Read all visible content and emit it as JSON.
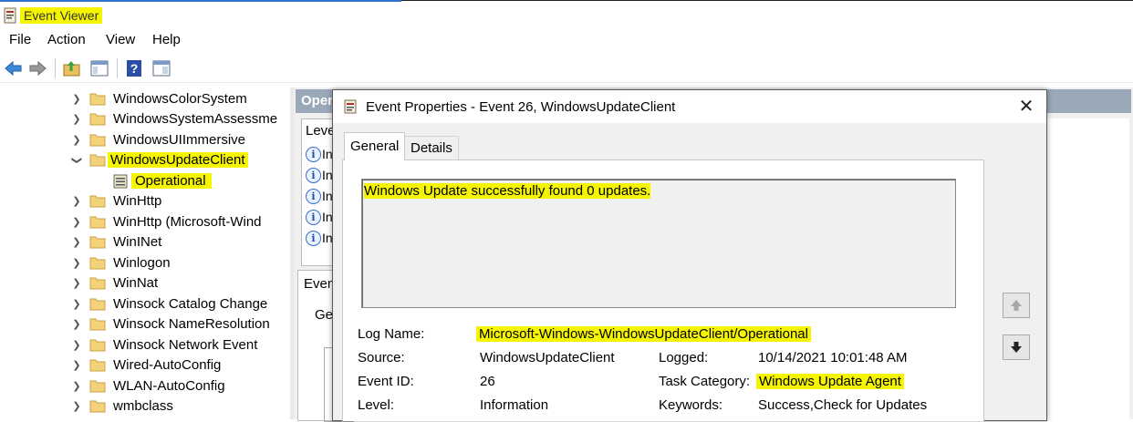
{
  "window": {
    "title": "Event Viewer"
  },
  "menu": [
    "File",
    "Action",
    "View",
    "Help"
  ],
  "toolbar": {
    "icons": [
      "back-arrow-icon",
      "forward-arrow-icon",
      "up-folder-icon",
      "show-hide-tree-icon",
      "help-icon",
      "properties-icon"
    ]
  },
  "tree": {
    "items": [
      {
        "label": "WindowsColorSystem",
        "expanded": false,
        "type": "folder"
      },
      {
        "label": "WindowsSystemAssessme",
        "expanded": false,
        "type": "folder"
      },
      {
        "label": "WindowsUIImmersive",
        "expanded": false,
        "type": "folder"
      },
      {
        "label": "WindowsUpdateClient",
        "expanded": true,
        "type": "folder"
      },
      {
        "label": "Operational",
        "type": "log"
      },
      {
        "label": "WinHttp",
        "expanded": false,
        "type": "folder"
      },
      {
        "label": "WinHttp (Microsoft-Wind",
        "expanded": false,
        "type": "folder"
      },
      {
        "label": "WinINet",
        "expanded": false,
        "type": "folder"
      },
      {
        "label": "Winlogon",
        "expanded": false,
        "type": "folder"
      },
      {
        "label": "WinNat",
        "expanded": false,
        "type": "folder"
      },
      {
        "label": "Winsock Catalog Change",
        "expanded": false,
        "type": "folder"
      },
      {
        "label": "Winsock NameResolution",
        "expanded": false,
        "type": "folder"
      },
      {
        "label": "Winsock Network Event",
        "expanded": false,
        "type": "folder"
      },
      {
        "label": "Wired-AutoConfig",
        "expanded": false,
        "type": "folder"
      },
      {
        "label": "WLAN-AutoConfig",
        "expanded": false,
        "type": "folder"
      },
      {
        "label": "wmbclass",
        "expanded": false,
        "type": "folder"
      }
    ]
  },
  "center": {
    "header": "Oper",
    "level_header": "Leve",
    "level_rows": [
      "In",
      "In",
      "In",
      "In",
      "In"
    ],
    "lower_header": "Even",
    "lower_tab": "Ge"
  },
  "dialog": {
    "title": "Event Properties - Event 26, WindowsUpdateClient",
    "tabs": [
      "General",
      "Details"
    ],
    "description": "Windows Update successfully found 0 updates.",
    "log_name_label": "Log Name:",
    "log_name": "Microsoft-Windows-WindowsUpdateClient/Operational",
    "source_label": "Source:",
    "source": "WindowsUpdateClient",
    "logged_label": "Logged:",
    "logged": "10/14/2021 10:01:48 AM",
    "event_id_label": "Event ID:",
    "event_id": "26",
    "task_category_label": "Task Category:",
    "task_category": "Windows Update Agent",
    "level_label": "Level:",
    "level": "Information",
    "keywords_label": "Keywords:",
    "keywords": "Success,Check for Updates"
  },
  "colors": {
    "highlight": "#f5f500",
    "header_bar": "#9aa8b8",
    "accent": "#2f6fd0"
  }
}
